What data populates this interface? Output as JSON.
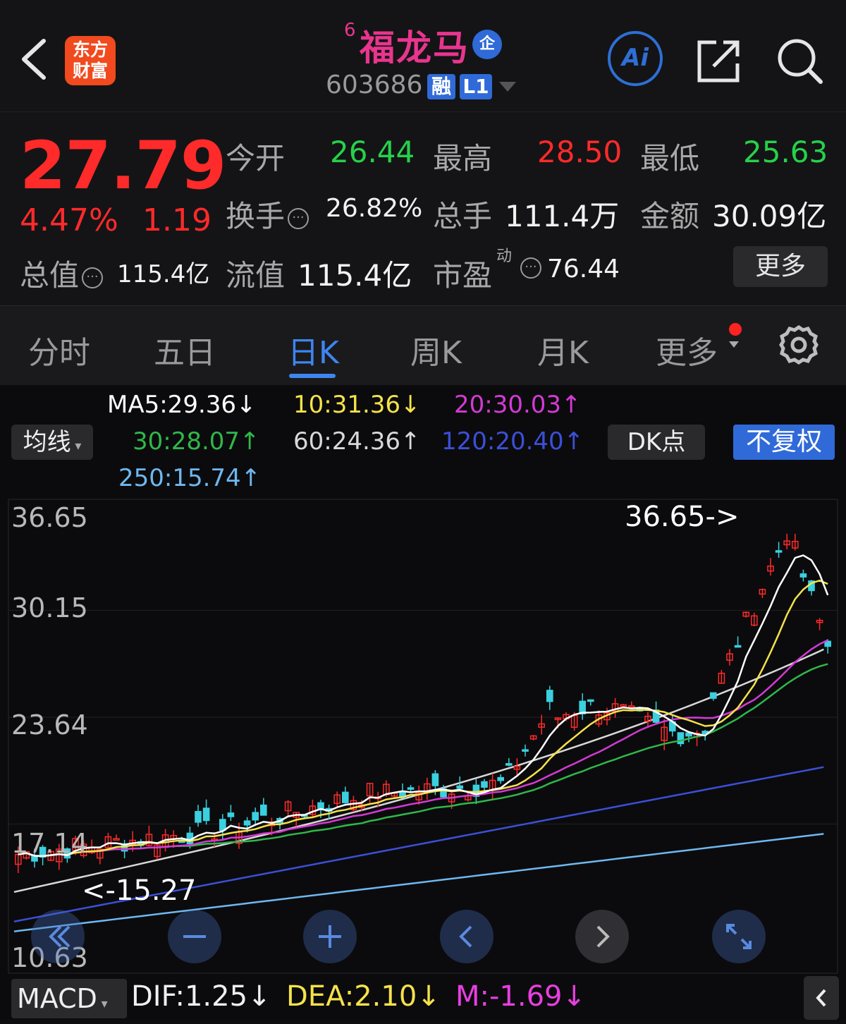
{
  "header": {
    "logo_line1": "东方",
    "logo_line2": "财富",
    "name_superscript": "6",
    "stock_name": "福龙马",
    "badge_qi": "企",
    "code": "603686",
    "tag_rong": "融",
    "tag_level": "L1",
    "ai_label": "Ai"
  },
  "quote": {
    "price": "27.79",
    "change_pct": "4.47%",
    "change_amt": "1.19",
    "open_label": "今开",
    "open": "26.44",
    "high_label": "最高",
    "high": "28.50",
    "low_label": "最低",
    "low": "25.63",
    "turnover_label": "换手",
    "turnover": "26.82%",
    "volume_label": "总手",
    "volume": "111.4万",
    "amount_label": "金额",
    "amount": "30.09亿",
    "total_cap_label": "总值",
    "total_cap": "115.4亿",
    "float_cap_label": "流值",
    "float_cap": "115.4亿",
    "pe_label": "市盈",
    "pe_sup": "动",
    "pe": "76.44",
    "more_label": "更多"
  },
  "tabs": [
    "分时",
    "五日",
    "日K",
    "周K",
    "月K",
    "更多"
  ],
  "chart": {
    "ma_selector": "均线",
    "dk_button": "DK点",
    "adjust_button": "不复权",
    "ma": {
      "ma5": "MA5:29.36↓",
      "ma10": "10:31.36↓",
      "ma20": "20:30.03↑",
      "ma30": "30:28.07↑",
      "ma60": "60:24.36↑",
      "ma120": "120:20.40↑",
      "ma250": "250:15.74↑"
    },
    "ma_colors": {
      "ma5": "#ffffff",
      "ma10": "#f5e24a",
      "ma20": "#d43ad4",
      "ma30": "#2fb84a",
      "ma60": "#d8d8d8",
      "ma120": "#3c4fd8",
      "ma250": "#6fb8f0"
    },
    "y_labels": [
      "36.65",
      "30.15",
      "23.64",
      "17.14",
      "10.63"
    ],
    "high_marker": "36.65->",
    "low_marker": "<-15.27",
    "up_color": "#ff2a2a",
    "down_color": "#3ad0e0"
  },
  "indicator": {
    "selector": "MACD",
    "dif": "DIF:1.25↓",
    "dea": "DEA:2.10↓",
    "m": "M:-1.69↓"
  }
}
